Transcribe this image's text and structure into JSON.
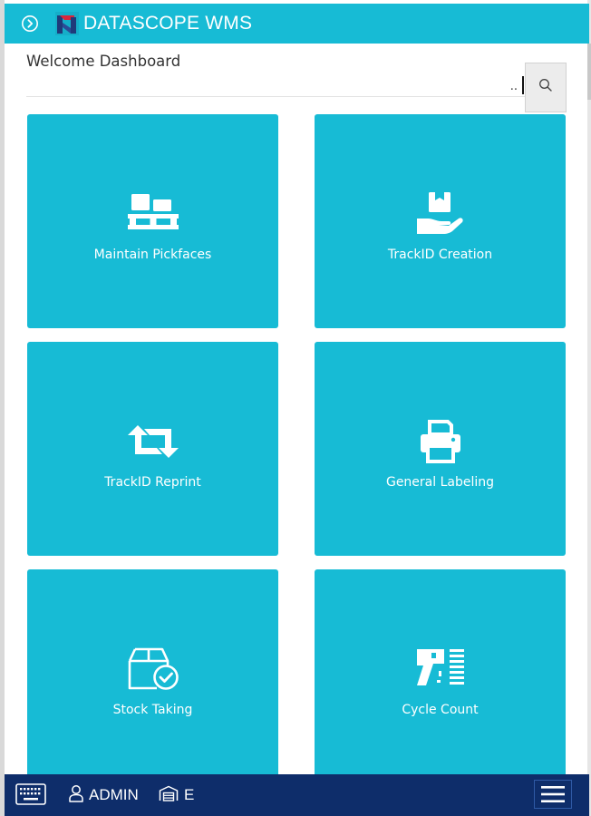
{
  "app": {
    "title": "DATASCOPE WMS",
    "brand_color": "#17bbd5",
    "footer_color": "#0e2d6a"
  },
  "header": {
    "nav_toggle_icon": "chevron-right-circle-icon",
    "logo_icon": "datascope-logo-icon"
  },
  "page": {
    "title": "Welcome Dashboard"
  },
  "search": {
    "value": "..",
    "icon": "search-icon"
  },
  "tiles": [
    {
      "label": "Maintain Pickfaces",
      "icon": "pallet-boxes-icon"
    },
    {
      "label": "TrackID Creation",
      "icon": "hand-box-icon"
    },
    {
      "label": "TrackID Reprint",
      "icon": "retweet-arrows-icon"
    },
    {
      "label": "General Labeling",
      "icon": "printer-icon"
    },
    {
      "label": "Stock Taking",
      "icon": "box-check-icon"
    },
    {
      "label": "Cycle Count",
      "icon": "barcode-scanner-icon"
    }
  ],
  "footer": {
    "keyboard_icon": "keyboard-icon",
    "user": {
      "icon": "user-icon",
      "label": "ADMIN"
    },
    "warehouse": {
      "icon": "warehouse-icon",
      "label": "E"
    },
    "menu_icon": "hamburger-menu-icon"
  }
}
